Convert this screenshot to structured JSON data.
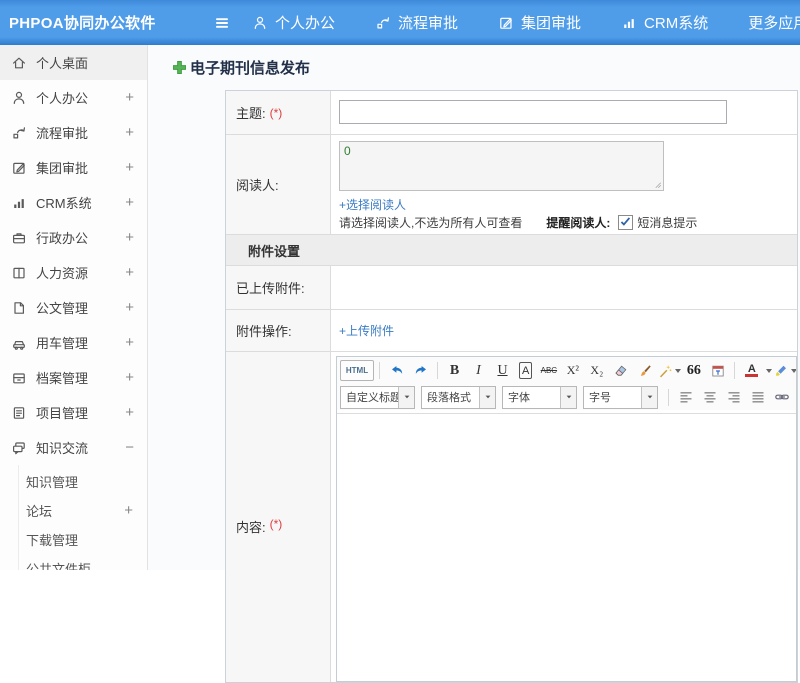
{
  "header": {
    "logo": "PHPOA协同办公软件",
    "nav": [
      {
        "label": "个人办公"
      },
      {
        "label": "流程审批"
      },
      {
        "label": "集团审批"
      },
      {
        "label": "CRM系统"
      },
      {
        "label": "更多应用"
      }
    ]
  },
  "sidebar": {
    "items": [
      {
        "label": "个人桌面",
        "expander": ""
      },
      {
        "label": "个人办公",
        "expander": "+"
      },
      {
        "label": "流程审批",
        "expander": "+"
      },
      {
        "label": "集团审批",
        "expander": "+"
      },
      {
        "label": "CRM系统",
        "expander": "+"
      },
      {
        "label": "行政办公",
        "expander": "+"
      },
      {
        "label": "人力资源",
        "expander": "+"
      },
      {
        "label": "公文管理",
        "expander": "+"
      },
      {
        "label": "用车管理",
        "expander": "+"
      },
      {
        "label": "档案管理",
        "expander": "+"
      },
      {
        "label": "项目管理",
        "expander": "+"
      },
      {
        "label": "知识交流",
        "expander": "−"
      }
    ],
    "subitems": [
      {
        "label": "知识管理",
        "expander": ""
      },
      {
        "label": "论坛",
        "expander": "+"
      },
      {
        "label": "下载管理",
        "expander": ""
      },
      {
        "label": "公共文件柜",
        "expander": ""
      }
    ]
  },
  "page": {
    "title": "电子期刊信息发布"
  },
  "form": {
    "subject_label": "主题:",
    "required_mark": "(*)",
    "readers_label": "阅读人:",
    "readers_count": "0",
    "select_readers_link": "+选择阅读人",
    "readers_hint": "请选择阅读人,不选为所有人可查看",
    "remind_readers_label": "提醒阅读人:",
    "sms_checkbox_label": "短消息提示",
    "sms_checked": true,
    "attachments_section_title": "附件设置",
    "uploaded_attachments_label": "已上传附件:",
    "attachment_actions_label": "附件操作:",
    "upload_attachment_link": "+上传附件",
    "content_label": "内容:"
  },
  "editor": {
    "html_source": "HTML",
    "bold": "B",
    "italic": "I",
    "underline": "U",
    "font_box": "A",
    "strikethrough": "ABC",
    "superscript": "X²",
    "subscript": "X₂",
    "blockquote": "66",
    "font_color": "A",
    "selects": [
      "自定义标题",
      "段落格式",
      "字体",
      "字号"
    ]
  },
  "colors": {
    "header_blue": "#4f9be8",
    "link_blue": "#3a7cc4",
    "required_red": "#e03c3c",
    "title_plus_green": "#57b357",
    "readers_count_green": "#2f7d32"
  }
}
